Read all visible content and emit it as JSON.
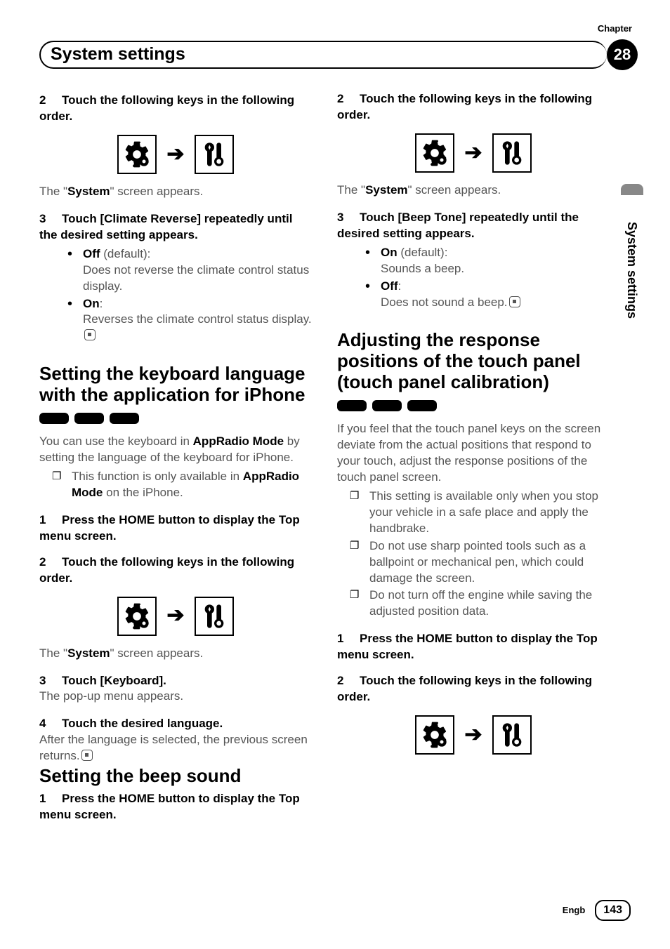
{
  "header": {
    "chapter_label": "Chapter",
    "chapter_num": "28",
    "title": "System settings",
    "side_tab": "System settings"
  },
  "left": {
    "s2": {
      "num": "2",
      "head": "Touch the following keys in the following order.",
      "caption_a": "The \"",
      "caption_b": "System",
      "caption_c": "\" screen appears."
    },
    "s3": {
      "num": "3",
      "head": "Touch [Climate Reverse] repeatedly until the desired setting appears.",
      "off_label": "Off",
      "off_hint": " (default):",
      "off_desc": "Does not reverse the climate control status display.",
      "on_label": "On",
      "on_hint": ":",
      "on_desc": "Reverses the climate control status display."
    },
    "kbd": {
      "title": "Setting the keyboard language with the application for iPhone",
      "p1a": "You can use the keyboard in ",
      "p1b": "AppRadio Mode",
      "p1c": " by setting the language of the keyboard for iPhone.",
      "note1a": "This function is only available in ",
      "note1b": "AppRadio Mode",
      "note1c": " on the iPhone.",
      "s1_num": "1",
      "s1_head": "Press the HOME button to display the Top menu screen.",
      "s2_num": "2",
      "s2_head": "Touch the following keys in the following order.",
      "caption_a": "The \"",
      "caption_b": "System",
      "caption_c": "\" screen appears.",
      "s3_num": "3",
      "s3_head": "Touch [Keyboard].",
      "s3_desc": "The pop-up menu appears.",
      "s4_num": "4",
      "s4_head": "Touch the desired language.",
      "s4_desc": "After the language is selected, the previous screen returns."
    }
  },
  "right": {
    "beep": {
      "title": "Setting the beep sound",
      "s1_num": "1",
      "s1_head": "Press the HOME button to display the Top menu screen.",
      "s2_num": "2",
      "s2_head": "Touch the following keys in the following order.",
      "caption_a": "The \"",
      "caption_b": "System",
      "caption_c": "\" screen appears.",
      "s3_num": "3",
      "s3_head": "Touch [Beep Tone] repeatedly until the desired setting appears.",
      "on_label": "On",
      "on_hint": " (default):",
      "on_desc": "Sounds a beep.",
      "off_label": "Off",
      "off_hint": ":",
      "off_desc": "Does not sound a beep."
    },
    "cal": {
      "title": "Adjusting the response positions of the touch panel (touch panel calibration)",
      "p1": "If you feel that the touch panel keys on the screen deviate from the actual positions that respond to your touch, adjust the response positions of the touch panel screen.",
      "n1": "This setting is available only when you stop your vehicle in a safe place and apply the handbrake.",
      "n2": "Do not use sharp pointed tools such as a ballpoint or mechanical pen, which could damage the screen.",
      "n3": "Do not turn off the engine while saving the adjusted position data.",
      "s1_num": "1",
      "s1_head": "Press the HOME button to display the Top menu screen.",
      "s2_num": "2",
      "s2_head": "Touch the following keys in the following order."
    }
  },
  "footer": {
    "lang": "Engb",
    "page": "143"
  }
}
